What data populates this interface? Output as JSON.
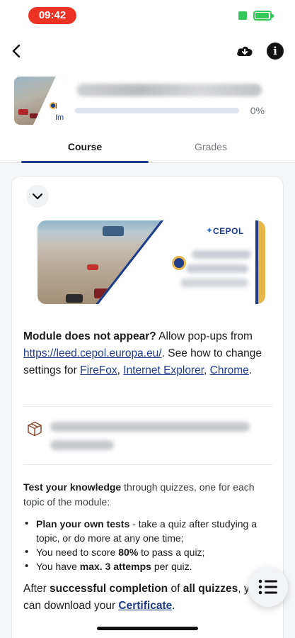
{
  "status_bar": {
    "time": "09:42"
  },
  "header": {
    "thumbnail_caption_1": "I",
    "thumbnail_caption_2": "Im",
    "progress_percent": 0,
    "progress_label": "0%"
  },
  "tabs": [
    {
      "label": "Course",
      "active": true
    },
    {
      "label": "Grades",
      "active": false
    }
  ],
  "banner": {
    "brand": "CEPOL"
  },
  "notice": {
    "lead": "Module does not appear?",
    "text_1": " Allow pop-ups from ",
    "link_leed": "https://leed.cepol.europa.eu/",
    "text_2": ". See how to change settings for ",
    "link_firefox": "FireFox",
    "sep_1": ", ",
    "link_ie": "Internet Explorer",
    "sep_2": ", ",
    "link_chrome": "Chrome",
    "end": "."
  },
  "test_section": {
    "intro_bold": "Test your knowledge",
    "intro_rest": " through quizzes, one for each topic of the module:",
    "bullet_1_bold": "Plan your own tests",
    "bullet_1_rest": " - take a quiz after studying a topic, or do more at any one time;",
    "bullet_2_pre": "You need to score ",
    "bullet_2_bold": "80%",
    "bullet_2_rest": " to pass a quiz;",
    "bullet_3_pre": "You have ",
    "bullet_3_bold": "max. 3 attemps",
    "bullet_3_rest": " per quiz."
  },
  "completion": {
    "pre": "After ",
    "bold_1": "successful completion",
    "mid": " of ",
    "bold_2": "all quizzes",
    "rest": ", you can download your ",
    "link_certificate": "Certificate",
    "end": "."
  },
  "colors": {
    "accent": "#1f3d8a",
    "gold": "#e6b64b",
    "time_pill": "#ea3323",
    "battery": "#34c759"
  }
}
